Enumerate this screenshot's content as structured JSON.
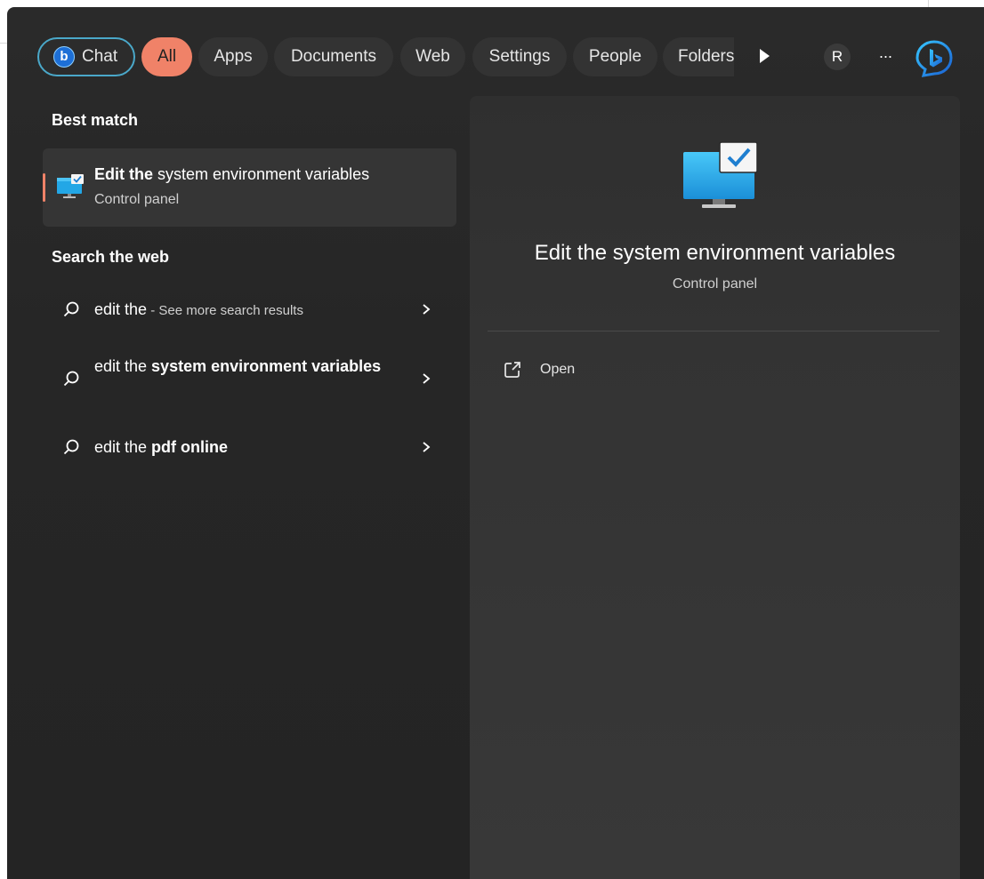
{
  "filters": {
    "chat": "Chat",
    "all": "All",
    "apps": "Apps",
    "documents": "Documents",
    "web": "Web",
    "settings": "Settings",
    "people": "People",
    "folders": "Folders",
    "avatar_initial": "R",
    "more": "···",
    "accent_color": "#f08268",
    "chat_border_color": "#4aa8c9"
  },
  "best_match": {
    "header": "Best match",
    "title_bold": "Edit the",
    "title_rest": " system environment variables",
    "subtitle": "Control panel",
    "icon": "monitor-checkmark-icon"
  },
  "search_web": {
    "header": "Search the web",
    "items": [
      {
        "plain": "edit the",
        "suffix": " - See more search results",
        "bold": ""
      },
      {
        "plain": "edit the ",
        "bold": "system environment variables",
        "suffix": ""
      },
      {
        "plain": "edit the ",
        "bold": "pdf online",
        "suffix": ""
      }
    ]
  },
  "preview": {
    "title": "Edit the system environment variables",
    "subtitle": "Control panel",
    "actions": [
      {
        "label": "Open",
        "icon": "open-external-icon"
      }
    ]
  }
}
